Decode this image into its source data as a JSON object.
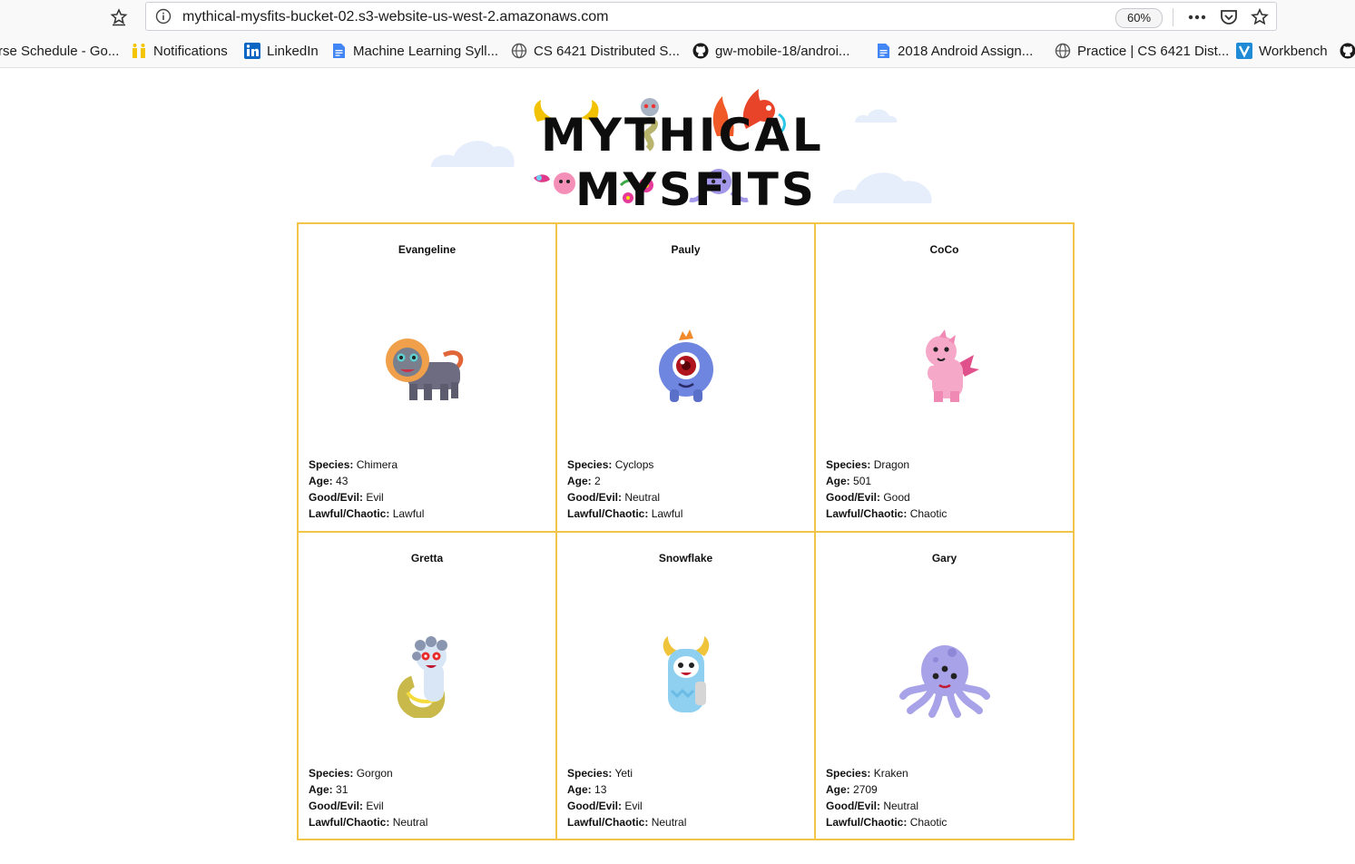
{
  "browser": {
    "url": "mythical-mysfits-bucket-02.s3-website-us-west-2.amazonaws.com",
    "zoom": "60%",
    "bookmarks": [
      {
        "label": "rse Schedule - Go...",
        "icon": "doc-icon"
      },
      {
        "label": "Notifications",
        "icon": "notifications-icon"
      },
      {
        "label": "LinkedIn",
        "icon": "linkedin-icon"
      },
      {
        "label": "Machine Learning Syll...",
        "icon": "doc-icon"
      },
      {
        "label": "CS 6421 Distributed S...",
        "icon": "globe-icon"
      },
      {
        "label": "gw-mobile-18/androi...",
        "icon": "github-icon"
      },
      {
        "label": "2018 Android Assign...",
        "icon": "doc-icon"
      },
      {
        "label": "Practice | CS 6421 Dist...",
        "icon": "globe-icon"
      },
      {
        "label": "Workbench",
        "icon": "workbench-icon"
      }
    ]
  },
  "page": {
    "logo": {
      "line1": "MYTHICAL",
      "line2": "MYSFITS"
    },
    "labels": {
      "species": "Species:",
      "age": "Age:",
      "good_evil": "Good/Evil:",
      "lawful_chaotic": "Lawful/Chaotic:"
    },
    "mysfits": [
      {
        "name": "Evangeline",
        "species": "Chimera",
        "age": "43",
        "good_evil": "Evil",
        "lawful_chaotic": "Lawful",
        "color": "#6e6c80"
      },
      {
        "name": "Pauly",
        "species": "Cyclops",
        "age": "2",
        "good_evil": "Neutral",
        "lawful_chaotic": "Lawful",
        "color": "#6f86e0"
      },
      {
        "name": "CoCo",
        "species": "Dragon",
        "age": "501",
        "good_evil": "Good",
        "lawful_chaotic": "Chaotic",
        "color": "#f6a8c8"
      },
      {
        "name": "Gretta",
        "species": "Gorgon",
        "age": "31",
        "good_evil": "Evil",
        "lawful_chaotic": "Neutral",
        "color": "#d8e6f5"
      },
      {
        "name": "Snowflake",
        "species": "Yeti",
        "age": "13",
        "good_evil": "Evil",
        "lawful_chaotic": "Neutral",
        "color": "#8fd0f0"
      },
      {
        "name": "Gary",
        "species": "Kraken",
        "age": "2709",
        "good_evil": "Neutral",
        "lawful_chaotic": "Chaotic",
        "color": "#a8a2e8"
      }
    ]
  },
  "colors": {
    "card_border": "#f3c44a",
    "logo_text": "#0d0d0d"
  }
}
